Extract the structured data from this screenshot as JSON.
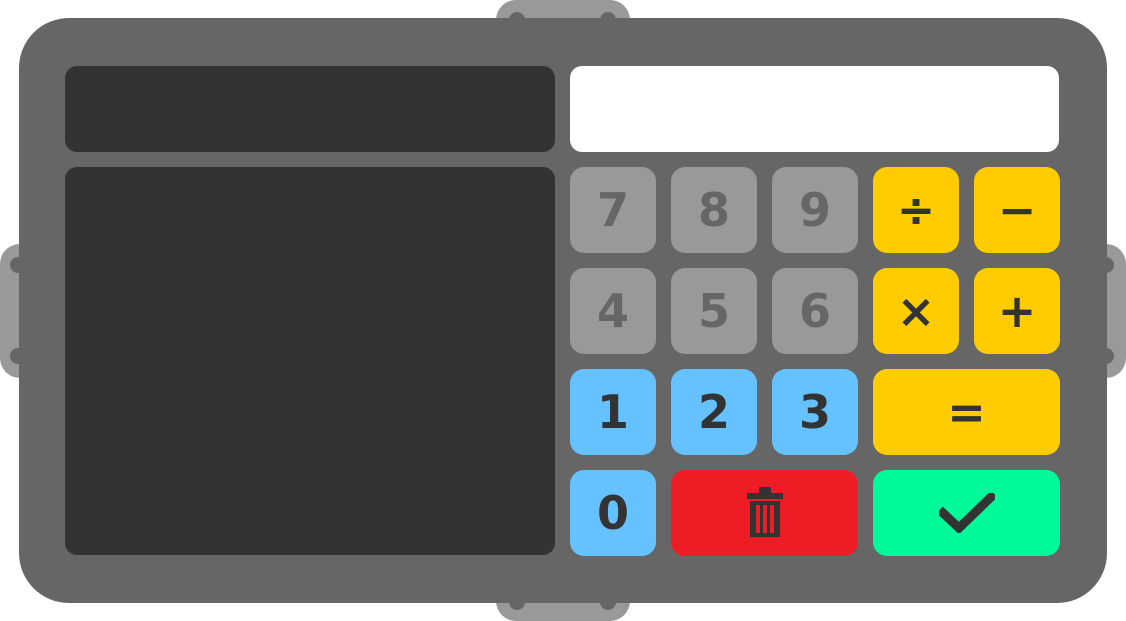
{
  "colors": {
    "frame": "#666666",
    "panel": "#333333",
    "display": "#ffffff",
    "clip": "#999999",
    "digit_key_grey": "#999999",
    "digit_key_blue": "#66c2ff",
    "operator_key": "#ffcc00",
    "delete_key": "#ee1c25",
    "confirm_key": "#00fa9a"
  },
  "display": {
    "value": ""
  },
  "keys": {
    "k7": "7",
    "k8": "8",
    "k9": "9",
    "k4": "4",
    "k5": "5",
    "k6": "6",
    "k1": "1",
    "k2": "2",
    "k3": "3",
    "k0": "0",
    "divide": "÷",
    "minus": "−",
    "multiply": "×",
    "plus": "+",
    "equals": "=",
    "delete_icon": "trash-icon",
    "confirm_icon": "checkmark-icon"
  }
}
